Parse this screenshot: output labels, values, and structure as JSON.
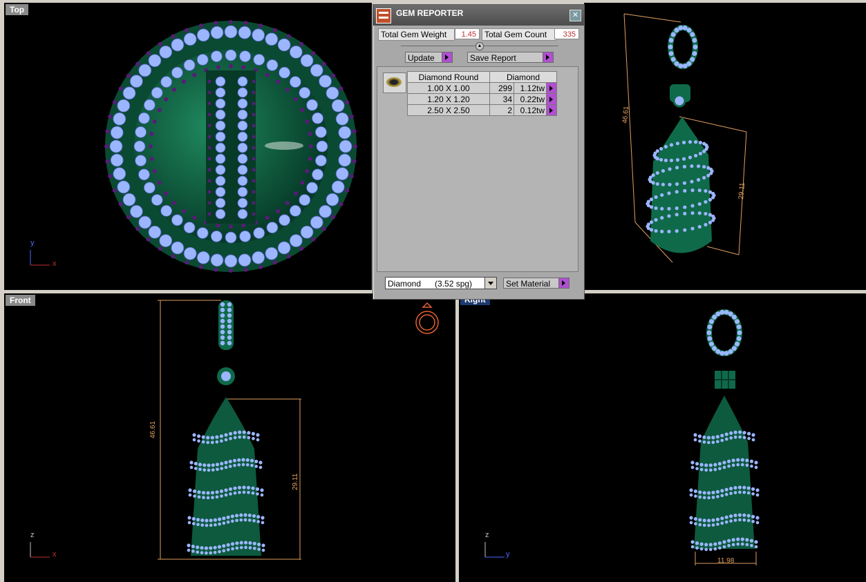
{
  "viewports": {
    "top": {
      "label": "Top",
      "axis1": "y",
      "axis2": "x"
    },
    "perspective": {
      "dim1": "46.61",
      "dim2": "29.11"
    },
    "front": {
      "label": "Front",
      "axis1": "z",
      "axis2": "x",
      "dim1": "46.61",
      "dim2": "29.11"
    },
    "right": {
      "label": "Right",
      "axis1": "z",
      "axis2": "y",
      "dim1": "11.98"
    }
  },
  "gem_reporter": {
    "title": "GEM REPORTER",
    "close_icon": "close-icon",
    "total_weight_label": "Total Gem Weight",
    "total_weight_value": "1.45",
    "total_count_label": "Total Gem Count",
    "total_count_value": "335",
    "update_label": "Update",
    "save_report_label": "Save Report",
    "table": {
      "col1": "Diamond Round",
      "col2": "Diamond",
      "rows": [
        {
          "size": "1.00 X 1.00",
          "count": "299",
          "weight": "1.12tw"
        },
        {
          "size": "1.20 X 1.20",
          "count": "34",
          "weight": "0.22tw"
        },
        {
          "size": "2.50 X 2.50",
          "count": "2",
          "weight": "0.12tw"
        }
      ]
    },
    "material_select": "Diamond      (3.52 spg)",
    "set_material_label": "Set Material"
  },
  "colors": {
    "metal": "#0f6a4a",
    "gem": "#9bb6ff",
    "prong": "#5a1a7a",
    "dimension": "#e0a060",
    "accent_button": "#b050d0"
  }
}
